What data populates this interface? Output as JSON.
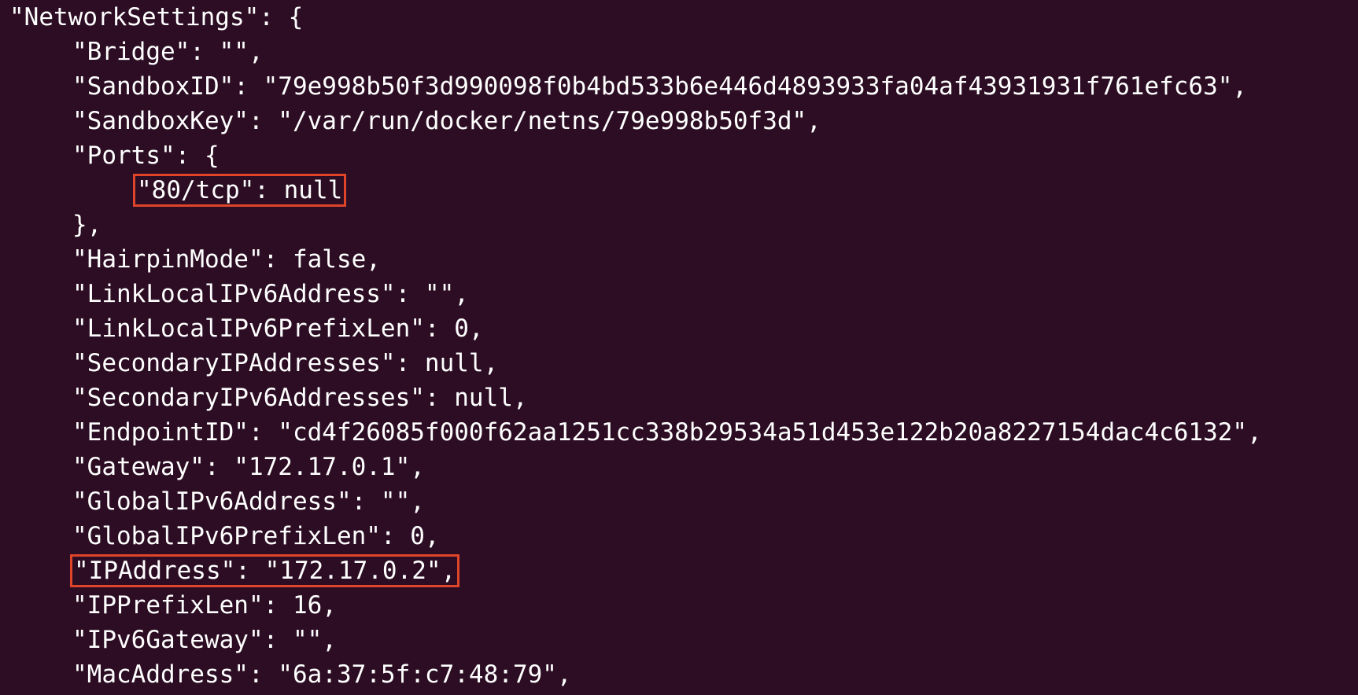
{
  "terminal": {
    "lines": [
      {
        "text": "\"NetworkSettings\": {",
        "indent": 0,
        "highlight": false
      },
      {
        "text": "\"Bridge\": \"\",",
        "indent": 1,
        "highlight": false
      },
      {
        "text": "\"SandboxID\": \"79e998b50f3d990098f0b4bd533b6e446d4893933fa04af43931931f761efc63\",",
        "indent": 1,
        "highlight": false
      },
      {
        "text": "\"SandboxKey\": \"/var/run/docker/netns/79e998b50f3d\",",
        "indent": 1,
        "highlight": false
      },
      {
        "text": "\"Ports\": {",
        "indent": 1,
        "highlight": false
      },
      {
        "text": "\"80/tcp\": null",
        "indent": 2,
        "highlight": true
      },
      {
        "text": "},",
        "indent": 1,
        "highlight": false
      },
      {
        "text": "\"HairpinMode\": false,",
        "indent": 1,
        "highlight": false
      },
      {
        "text": "\"LinkLocalIPv6Address\": \"\",",
        "indent": 1,
        "highlight": false
      },
      {
        "text": "\"LinkLocalIPv6PrefixLen\": 0,",
        "indent": 1,
        "highlight": false
      },
      {
        "text": "\"SecondaryIPAddresses\": null,",
        "indent": 1,
        "highlight": false
      },
      {
        "text": "\"SecondaryIPv6Addresses\": null,",
        "indent": 1,
        "highlight": false
      },
      {
        "text": "\"EndpointID\": \"cd4f26085f000f62aa1251cc338b29534a51d453e122b20a8227154dac4c6132\",",
        "indent": 1,
        "highlight": false
      },
      {
        "text": "\"Gateway\": \"172.17.0.1\",",
        "indent": 1,
        "highlight": false
      },
      {
        "text": "\"GlobalIPv6Address\": \"\",",
        "indent": 1,
        "highlight": false
      },
      {
        "text": "\"GlobalIPv6PrefixLen\": 0,",
        "indent": 1,
        "highlight": false
      },
      {
        "text": "\"IPAddress\": \"172.17.0.2\",",
        "indent": 1,
        "highlight": true
      },
      {
        "text": "\"IPPrefixLen\": 16,",
        "indent": 1,
        "highlight": false
      },
      {
        "text": "\"IPv6Gateway\": \"\",",
        "indent": 1,
        "highlight": false
      },
      {
        "text": "\"MacAddress\": \"6a:37:5f:c7:48:79\",",
        "indent": 1,
        "highlight": false
      }
    ]
  },
  "colors": {
    "background": "#2c0d23",
    "text": "#ffffff",
    "highlight_box": "#e0452a"
  }
}
